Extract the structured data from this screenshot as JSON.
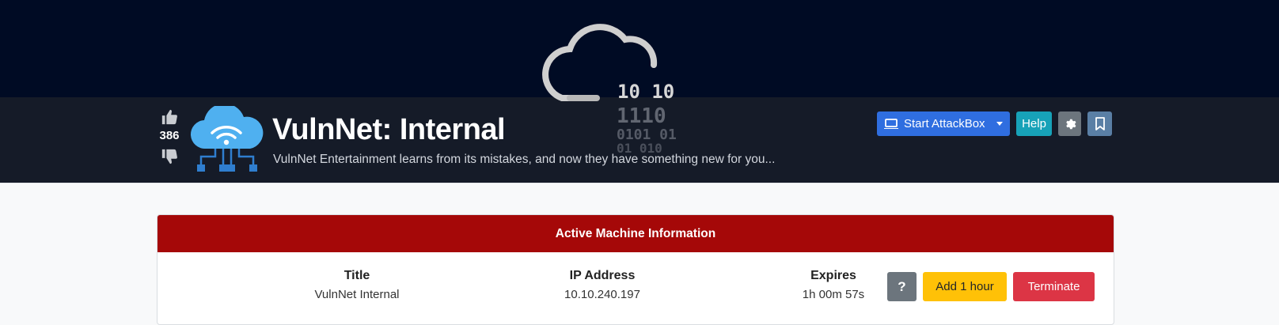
{
  "room": {
    "title": "VulnNet: Internal",
    "description": "VulnNet Entertainment learns from its mistakes, and now they have something new for you...",
    "votes": "386",
    "background_digits": [
      "10  10",
      "1110",
      "0101   01",
      "01      010"
    ]
  },
  "actions": {
    "attackbox_label": "Start AttackBox",
    "help_label": "Help"
  },
  "icons": {
    "laptop": "laptop-icon",
    "gear": "gear-icon",
    "bookmark": "bookmark-icon",
    "thumbs_up": "thumbs-up-icon",
    "thumbs_down": "thumbs-down-icon",
    "room": "cloud-network-icon"
  },
  "machine": {
    "heading": "Active Machine Information",
    "columns": [
      {
        "label": "Title",
        "value": "VulnNet Internal"
      },
      {
        "label": "IP Address",
        "value": "10.10.240.197"
      },
      {
        "label": "Expires",
        "value": "1h 00m 57s"
      }
    ],
    "help_label": "?",
    "add_hour_label": "Add 1 hour",
    "terminate_label": "Terminate"
  },
  "colors": {
    "hero_dark": "#000b24",
    "hero_band": "#151b28",
    "panel_header": "#a50808",
    "primary": "#2f6ee0",
    "info": "#17a2b8",
    "warning": "#ffc107",
    "danger": "#dc3545"
  }
}
